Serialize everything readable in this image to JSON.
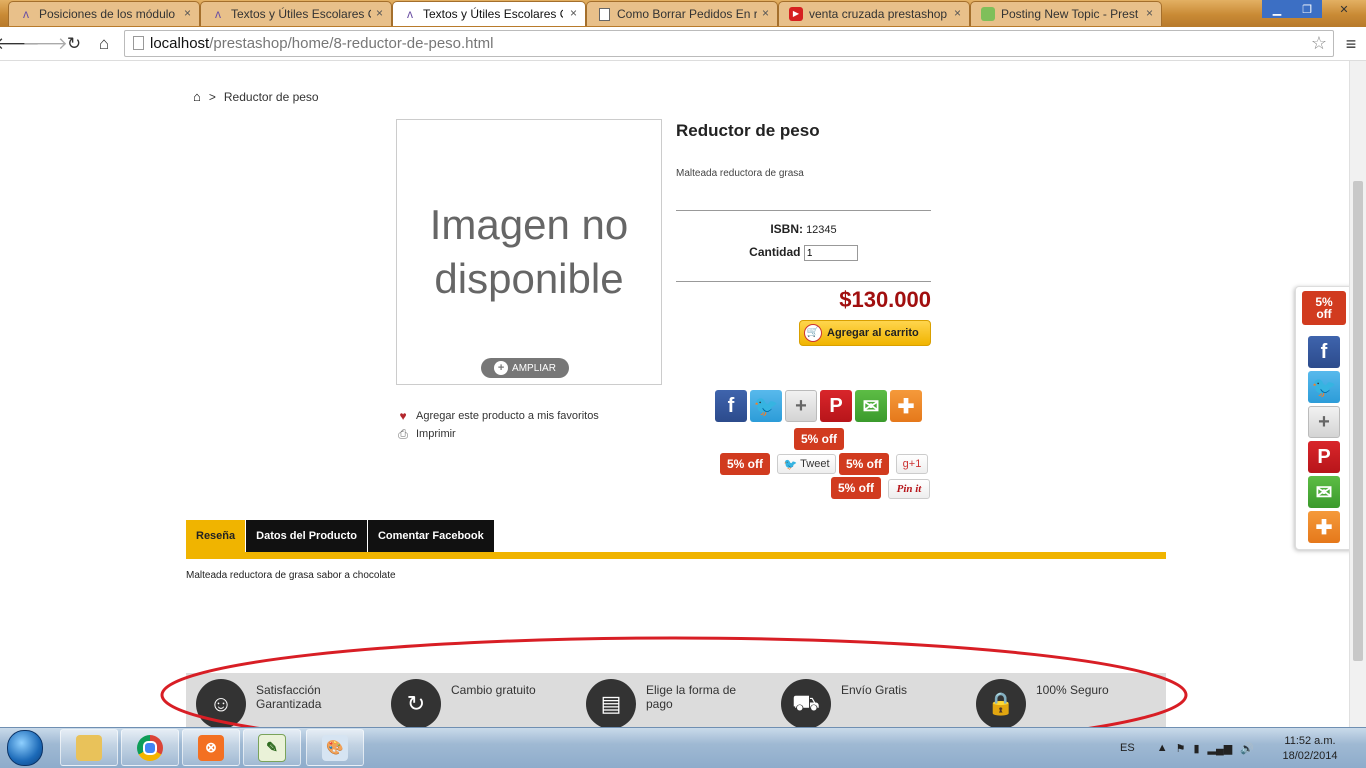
{
  "browser": {
    "tabs": [
      {
        "title": "Posiciones de los módulo",
        "icon": "prestashop-icon",
        "active": false
      },
      {
        "title": "Textos y Útiles Escolares O",
        "icon": "prestashop-icon",
        "active": false
      },
      {
        "title": "Textos y Útiles Escolares O",
        "icon": "prestashop-icon",
        "active": true
      },
      {
        "title": "Como Borrar Pedidos En r",
        "icon": "document-icon",
        "active": false
      },
      {
        "title": "venta cruzada prestashop",
        "icon": "youtube-icon",
        "active": false
      },
      {
        "title": "Posting New Topic - Prest",
        "icon": "forum-icon",
        "active": false
      }
    ],
    "close_glyph": "×",
    "url_host": "localhost",
    "url_path": "/prestashop/home/8-reductor-de-peso.html"
  },
  "breadcrumb": {
    "separator": ">",
    "current": "Reductor de peso"
  },
  "product": {
    "image_placeholder": "Imagen no disponible",
    "zoom_label": "AMPLIAR",
    "wishlist_label": "Agregar este producto a mis favoritos",
    "print_label": "Imprimir",
    "title": "Reductor de peso",
    "short_description": "Malteada reductora de grasa",
    "isbn_label": "ISBN:",
    "isbn_value": "12345",
    "quantity_label": "Cantidad",
    "quantity_value": "1",
    "price": "$130.000",
    "add_to_cart_label": "Agregar al carrito"
  },
  "share": {
    "discount_label": "5% off",
    "tweet_label": "Tweet",
    "gplus_label": "g+1",
    "pinit_label": "Pin it"
  },
  "tabs": {
    "items": [
      "Reseña",
      "Datos del Producto",
      "Comentar Facebook"
    ],
    "content": "Malteada reductora de grasa sabor a chocolate"
  },
  "reassurance": [
    {
      "label": "Satisfacción Garantizada",
      "icon": "smiley-icon"
    },
    {
      "label": "Cambio gratuito",
      "icon": "refresh-icon"
    },
    {
      "label": "Elige la forma de pago",
      "icon": "card-icon"
    },
    {
      "label": "Envío Gratis",
      "icon": "truck-icon"
    },
    {
      "label": "100% Seguro",
      "icon": "lock-icon"
    }
  ],
  "floatbar": {
    "discount_label": "5%\noff"
  },
  "taskbar": {
    "language": "ES",
    "time": "11:52 a.m.",
    "date": "18/02/2014"
  },
  "colors": {
    "accent_yellow": "#f0b400",
    "price_red": "#a10f0f",
    "annotation_red": "#d81e25"
  }
}
